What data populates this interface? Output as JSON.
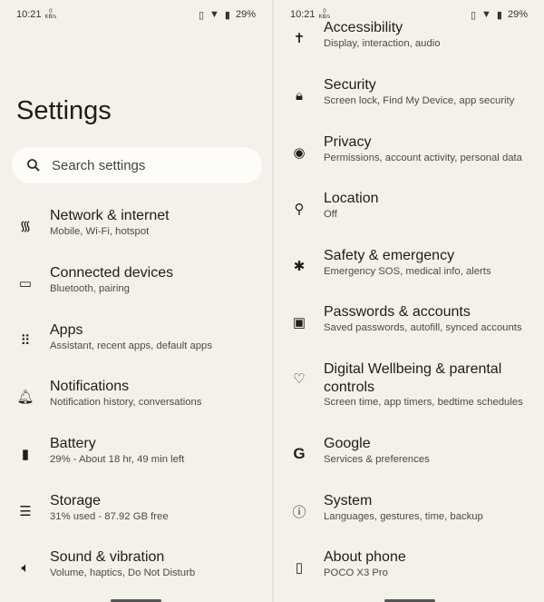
{
  "status": {
    "time": "10:21",
    "net_speed": "0",
    "net_unit": "KB/s",
    "battery": "29%"
  },
  "left": {
    "title": "Settings",
    "search_placeholder": "Search settings",
    "items": [
      {
        "title": "Network & internet",
        "subtitle": "Mobile, Wi-Fi, hotspot",
        "icon": "wifi-icon"
      },
      {
        "title": "Connected devices",
        "subtitle": "Bluetooth, pairing",
        "icon": "devices-icon"
      },
      {
        "title": "Apps",
        "subtitle": "Assistant, recent apps, default apps",
        "icon": "apps-grid-icon"
      },
      {
        "title": "Notifications",
        "subtitle": "Notification history, conversations",
        "icon": "bell-icon"
      },
      {
        "title": "Battery",
        "subtitle": "29% - About 18 hr, 49 min left",
        "icon": "battery-icon"
      },
      {
        "title": "Storage",
        "subtitle": "31% used - 87.92 GB free",
        "icon": "storage-icon"
      },
      {
        "title": "Sound & vibration",
        "subtitle": "Volume, haptics, Do Not Disturb",
        "icon": "speaker-icon"
      }
    ]
  },
  "right": {
    "items": [
      {
        "title": "Accessibility",
        "subtitle": "Display, interaction, audio",
        "icon": "accessibility-icon"
      },
      {
        "title": "Security",
        "subtitle": "Screen lock, Find My Device, app security",
        "icon": "lock-icon"
      },
      {
        "title": "Privacy",
        "subtitle": "Permissions, account activity, personal data",
        "icon": "eye-icon"
      },
      {
        "title": "Location",
        "subtitle": "Off",
        "icon": "location-pin-icon"
      },
      {
        "title": "Safety & emergency",
        "subtitle": "Emergency SOS, medical info, alerts",
        "icon": "asterisk-icon"
      },
      {
        "title": "Passwords & accounts",
        "subtitle": "Saved passwords, autofill, synced accounts",
        "icon": "account-box-icon"
      },
      {
        "title": "Digital Wellbeing & parental controls",
        "subtitle": "Screen time, app timers, bedtime schedules",
        "icon": "wellbeing-icon"
      },
      {
        "title": "Google",
        "subtitle": "Services & preferences",
        "icon": "google-icon"
      },
      {
        "title": "System",
        "subtitle": "Languages, gestures, time, backup",
        "icon": "info-icon"
      },
      {
        "title": "About phone",
        "subtitle": "POCO X3 Pro",
        "icon": "phone-icon"
      }
    ]
  }
}
